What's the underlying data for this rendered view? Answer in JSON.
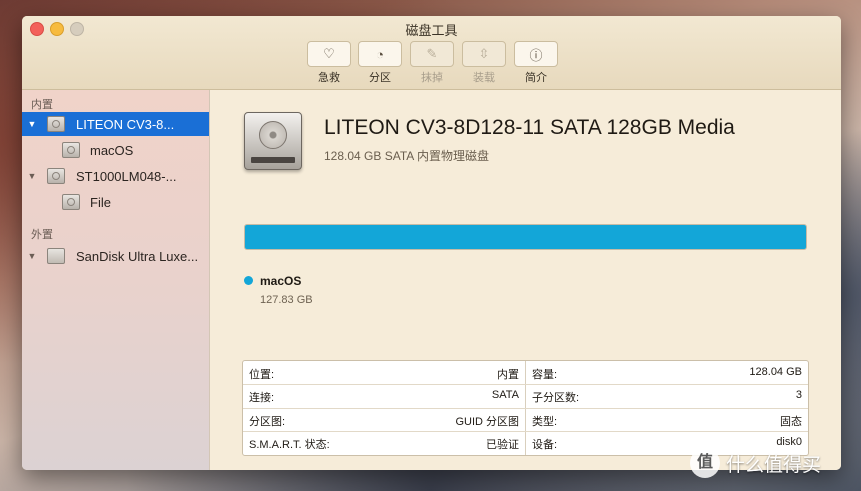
{
  "window": {
    "title": "磁盘工具"
  },
  "toolbar": {
    "buttons": [
      {
        "label": "急救",
        "icon": "stethoscope-icon",
        "glyph": "♡",
        "enabled": true
      },
      {
        "label": "分区",
        "icon": "partition-pie-icon",
        "glyph": "◔",
        "enabled": true
      },
      {
        "label": "抹掉",
        "icon": "erase-icon",
        "glyph": "✎",
        "enabled": false
      },
      {
        "label": "装载",
        "icon": "mount-icon",
        "glyph": "⇳",
        "enabled": false
      },
      {
        "label": "简介",
        "icon": "info-icon",
        "glyph": "ⓘ",
        "enabled": true
      }
    ]
  },
  "sidebar": {
    "internal_label": "内置",
    "external_label": "外置",
    "items": [
      {
        "label": "LITEON CV3-8...",
        "level": 0,
        "selected": true,
        "icon": "internal-disk-icon"
      },
      {
        "label": "macOS",
        "level": 1,
        "selected": false,
        "icon": "volume-icon"
      },
      {
        "label": "ST1000LM048-...",
        "level": 0,
        "selected": false,
        "icon": "internal-disk-icon"
      },
      {
        "label": "File",
        "level": 1,
        "selected": false,
        "icon": "volume-icon"
      },
      {
        "label": "SanDisk Ultra Luxe...",
        "level": 0,
        "selected": false,
        "icon": "external-disk-icon"
      }
    ]
  },
  "main": {
    "disk_name": "LITEON CV3-8D128-11 SATA 128GB Media",
    "disk_subtitle": "128.04 GB SATA 内置物理磁盘",
    "usage": {
      "fill_fraction": 1.0,
      "color": "#13a6d8"
    },
    "legend": {
      "name": "macOS",
      "size": "127.83 GB"
    },
    "info": {
      "left": [
        {
          "key": "位置:",
          "value": "内置"
        },
        {
          "key": "连接:",
          "value": "SATA"
        },
        {
          "key": "分区图:",
          "value": "GUID 分区图"
        },
        {
          "key": "S.M.A.R.T. 状态:",
          "value": "已验证"
        }
      ],
      "right": [
        {
          "key": "容量:",
          "value": "128.04 GB"
        },
        {
          "key": "子分区数:",
          "value": "3"
        },
        {
          "key": "类型:",
          "value": "固态"
        },
        {
          "key": "设备:",
          "value": "disk0"
        }
      ]
    }
  },
  "watermark": {
    "badge": "值",
    "text": "什么值得买"
  }
}
